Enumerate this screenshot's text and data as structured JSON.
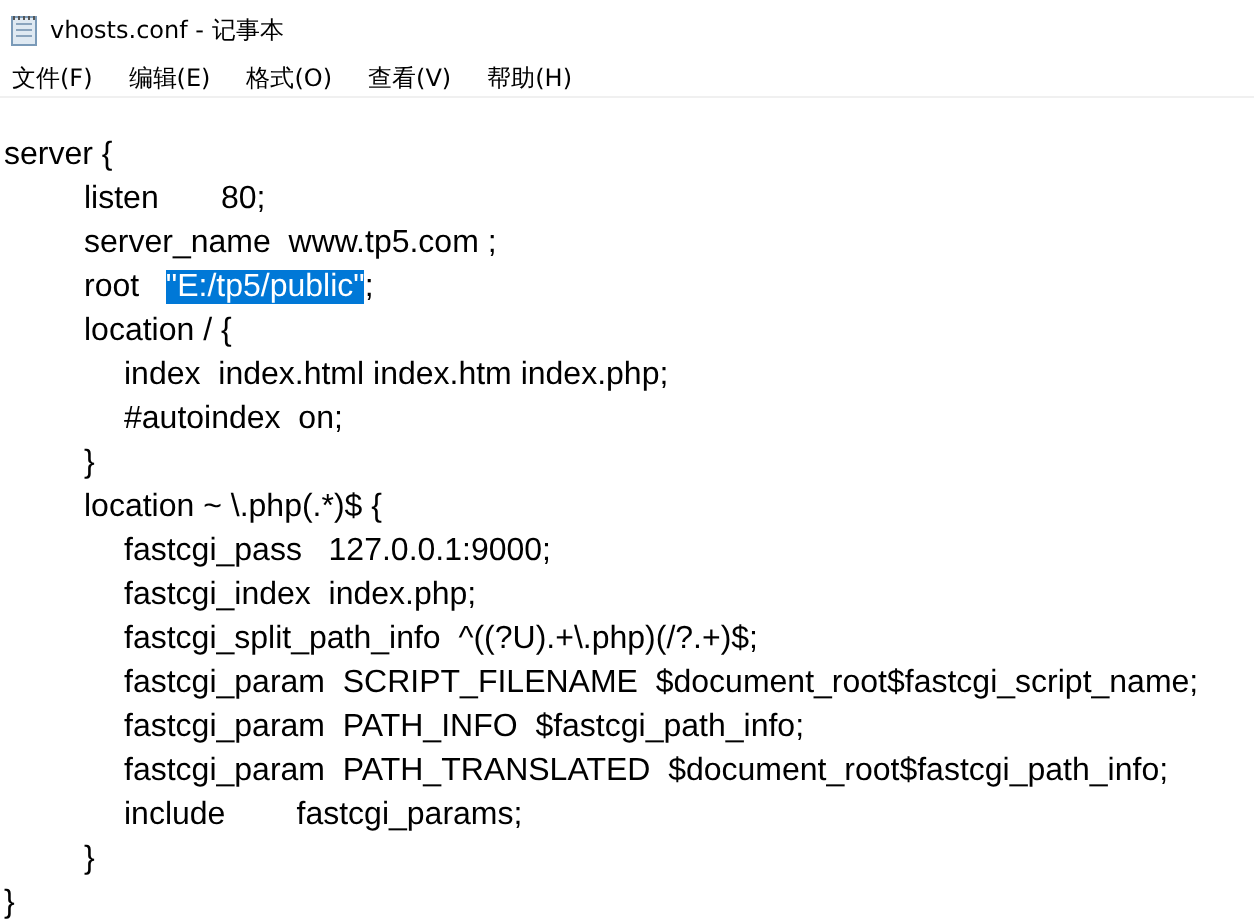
{
  "window": {
    "title": "vhosts.conf - 记事本"
  },
  "menu": [
    {
      "label": "文件(F)"
    },
    {
      "label": "编辑(E)"
    },
    {
      "label": "格式(O)"
    },
    {
      "label": "查看(V)"
    },
    {
      "label": "帮助(H)"
    }
  ],
  "lines": [
    {
      "text": "server {",
      "children": [
        {
          "text": "listen       80;"
        },
        {
          "text": "server_name  www.tp5.com ;"
        },
        {
          "parts": [
            {
              "text": "root   ",
              "selected": false
            },
            {
              "text": "\"E:/tp5/public\"",
              "selected": true
            },
            {
              "text": ";",
              "selected": false
            }
          ]
        },
        {
          "text": "location / {",
          "children": [
            {
              "text": "index  index.html index.htm index.php;"
            },
            {
              "text": "#autoindex  on;"
            }
          ]
        },
        {
          "text": "}"
        },
        {
          "text": "location ~ \\.php(.*)$ {",
          "children": [
            {
              "text": "fastcgi_pass   127.0.0.1:9000;"
            },
            {
              "text": "fastcgi_index  index.php;"
            },
            {
              "text": "fastcgi_split_path_info  ^((?U).+\\.php)(/?.+)$;"
            },
            {
              "text": "fastcgi_param  SCRIPT_FILENAME  $document_root$fastcgi_script_name;"
            },
            {
              "text": "fastcgi_param  PATH_INFO  $fastcgi_path_info;"
            },
            {
              "text": "fastcgi_param  PATH_TRANSLATED  $document_root$fastcgi_path_info;"
            },
            {
              "text": "include        fastcgi_params;"
            }
          ]
        },
        {
          "text": "}"
        }
      ]
    },
    {
      "text": "}"
    }
  ]
}
